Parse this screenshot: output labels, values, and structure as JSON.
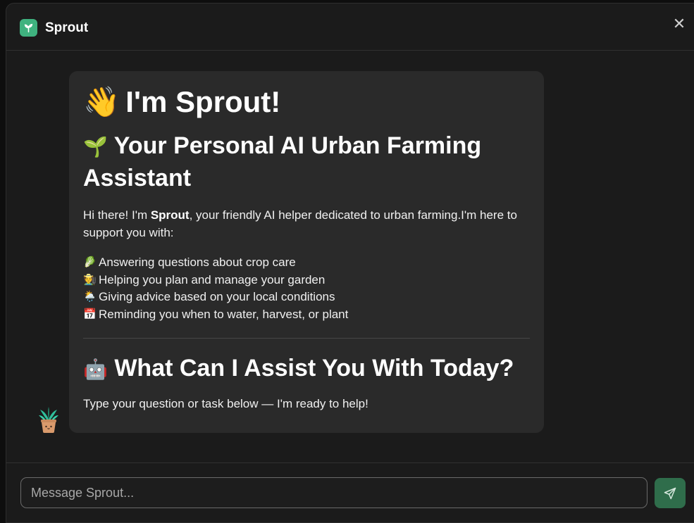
{
  "header": {
    "title": "Sprout",
    "logo_icon": "leaf-icon",
    "close_icon": "close-icon",
    "close_glyph": "✕"
  },
  "message": {
    "heading_emoji": "👋",
    "heading": "I'm Sprout!",
    "subheading_emoji": "🌱",
    "subheading": "Your Personal AI Urban Farming Assistant",
    "intro_prefix": "Hi there! I'm ",
    "intro_name": "Sprout",
    "intro_suffix": ", your friendly AI helper dedicated to urban farming.I'm here to support you with:",
    "capabilities": [
      {
        "emoji": "🥬",
        "text": "Answering questions about crop care"
      },
      {
        "emoji": "🧑‍🌾",
        "text": "Helping you plan and manage your garden"
      },
      {
        "emoji": "🌦️",
        "text": "Giving advice based on your local conditions"
      },
      {
        "emoji": "📅",
        "text": "Reminding you when to water, harvest, or plant"
      }
    ],
    "question_emoji": "🤖",
    "question_heading": "What Can I Assist You With Today?",
    "prompt": "Type your question or task below — I'm ready to help!"
  },
  "composer": {
    "placeholder": "Message Sprout...",
    "value": "",
    "send_icon": "send-icon"
  },
  "colors": {
    "brand": "#3fb27f",
    "send_button": "#2f6d4b",
    "bubble": "#2a2a2a",
    "background": "#1b1b1b"
  }
}
